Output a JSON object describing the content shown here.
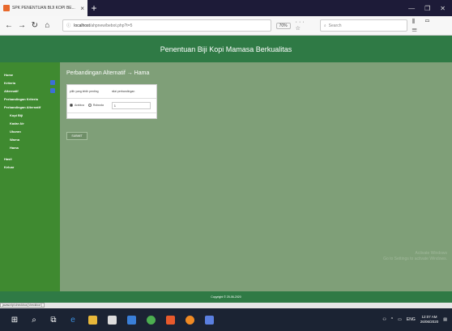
{
  "browser": {
    "tab_title": "SPK PENENTUAN BIJI KOPI BE...",
    "url_prefix": "localhost",
    "url_path": "/ahpnew/bebot.php?t=5",
    "zoom": "70%",
    "search_placeholder": "Search"
  },
  "header": {
    "title": "Penentuan Biji Kopi Mamasa Berkualitas"
  },
  "sidebar": {
    "items": [
      {
        "label": "Home"
      },
      {
        "label": "Kriteria"
      },
      {
        "label": "Alternatif"
      },
      {
        "label": "Perbandingan Kriteria"
      },
      {
        "label": "Perbandingan Alternatif"
      },
      {
        "label": "Kopi Biji"
      },
      {
        "label": "Kadar Air"
      },
      {
        "label": "Ukuran"
      },
      {
        "label": "Warna"
      },
      {
        "label": "Hama"
      },
      {
        "label": "Hasil"
      },
      {
        "label": "Keluar"
      }
    ]
  },
  "main": {
    "heading": "Perbandingan Alternatif → Hama",
    "table": {
      "headers": [
        "pilih yang lebih penting",
        "nilai perbandingan"
      ],
      "option_a": "Arabica",
      "option_b": "Robusta",
      "value": "1"
    },
    "submit_label": "SUBMIT"
  },
  "watermark": {
    "line1": "Activate Windows",
    "line2": "Go to Settings to activate Windows."
  },
  "footer": {
    "text": "Copyright © 25-06-2020"
  },
  "statusline": {
    "text": "javascript:checkbox('checkbox')"
  },
  "taskbar": {
    "time": "12:07 AM",
    "date": "26/06/2020",
    "lang": "ENG"
  },
  "colors": {
    "header": "#2f7a45",
    "sidebar": "#3f8a30",
    "main_bg": "#7f9f78",
    "badge": "#3b6fd8"
  }
}
